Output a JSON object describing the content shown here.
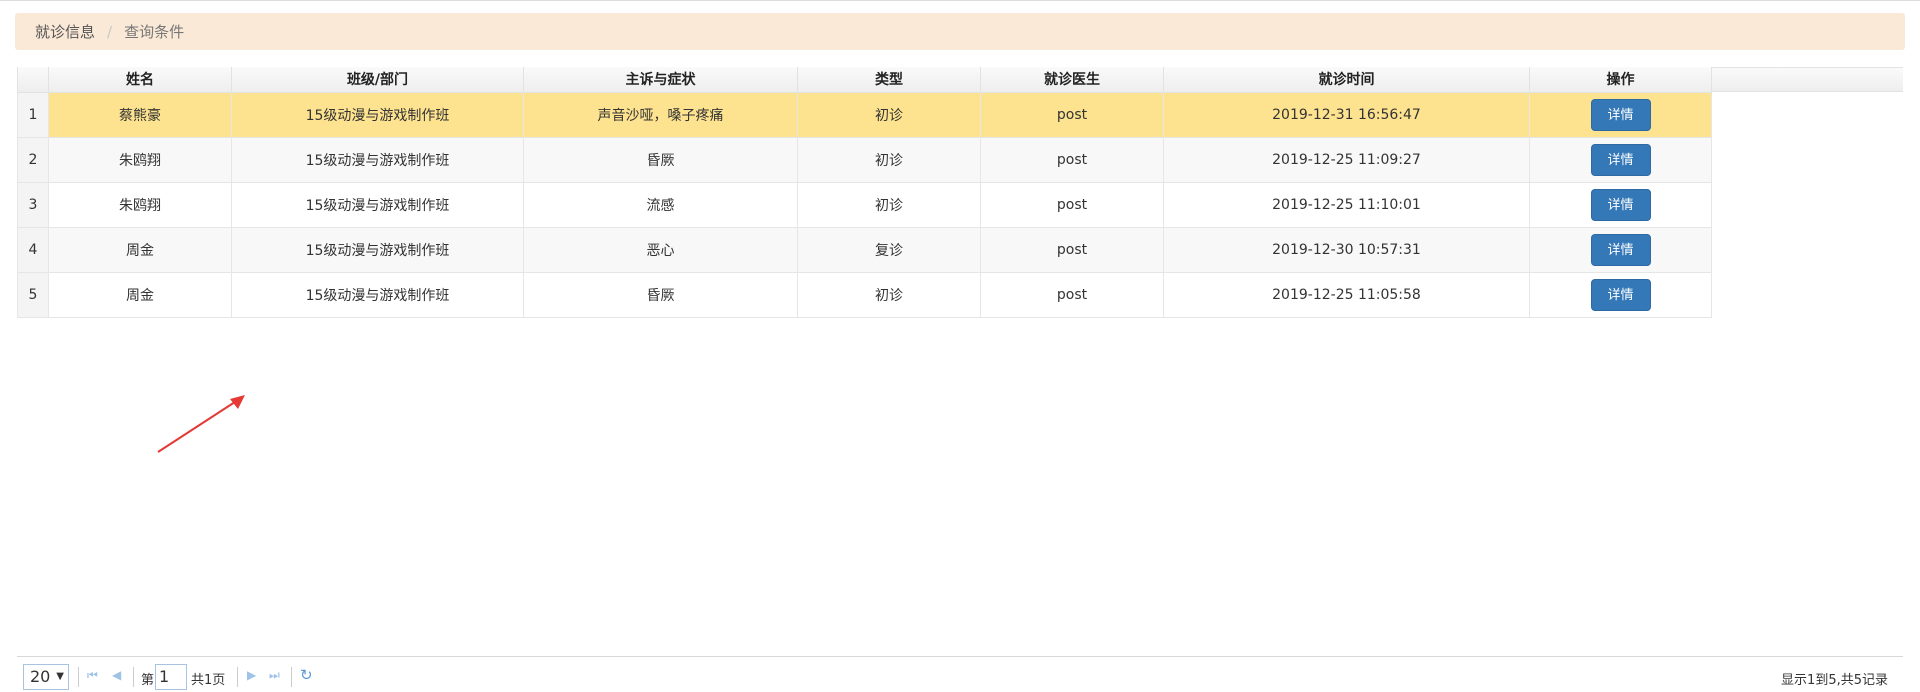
{
  "breadcrumb": {
    "items": [
      "就诊信息",
      "查询条件"
    ],
    "separator": "/"
  },
  "table": {
    "columns": [
      "姓名",
      "班级/部门",
      "主诉与症状",
      "类型",
      "就诊医生",
      "就诊时间",
      "操作"
    ],
    "rows": [
      {
        "index": "1",
        "name": "蔡熊豪",
        "dept": "15级动漫与游戏制作班",
        "symptom": "声音沙哑，嗓子疼痛",
        "type": "初诊",
        "doctor": "post",
        "time": "2019-12-31 16:56:47",
        "action": "详情"
      },
      {
        "index": "2",
        "name": "朱鸥翔",
        "dept": "15级动漫与游戏制作班",
        "symptom": "昏厥",
        "type": "初诊",
        "doctor": "post",
        "time": "2019-12-25 11:09:27",
        "action": "详情"
      },
      {
        "index": "3",
        "name": "朱鸥翔",
        "dept": "15级动漫与游戏制作班",
        "symptom": "流感",
        "type": "初诊",
        "doctor": "post",
        "time": "2019-12-25 11:10:01",
        "action": "详情"
      },
      {
        "index": "4",
        "name": "周金",
        "dept": "15级动漫与游戏制作班",
        "symptom": "恶心",
        "type": "复诊",
        "doctor": "post",
        "time": "2019-12-30 10:57:31",
        "action": "详情"
      },
      {
        "index": "5",
        "name": "周金",
        "dept": "15级动漫与游戏制作班",
        "symptom": "昏厥",
        "type": "初诊",
        "doctor": "post",
        "time": "2019-12-25 11:05:58",
        "action": "详情"
      }
    ],
    "selected_row": 1
  },
  "pager": {
    "page_size": "20",
    "page_prefix": "第",
    "page_value": "1",
    "page_total": "共1页",
    "info": "显示1到5,共5记录",
    "icons": [
      "first-page-icon",
      "prev-page-icon",
      "next-page-icon",
      "last-page-icon",
      "refresh-icon"
    ]
  },
  "colors": {
    "breadcrumb_bg": "#fbe9d7",
    "selected_row": "#fde38f",
    "button": "#3478b8",
    "arrow": "#e53935"
  }
}
